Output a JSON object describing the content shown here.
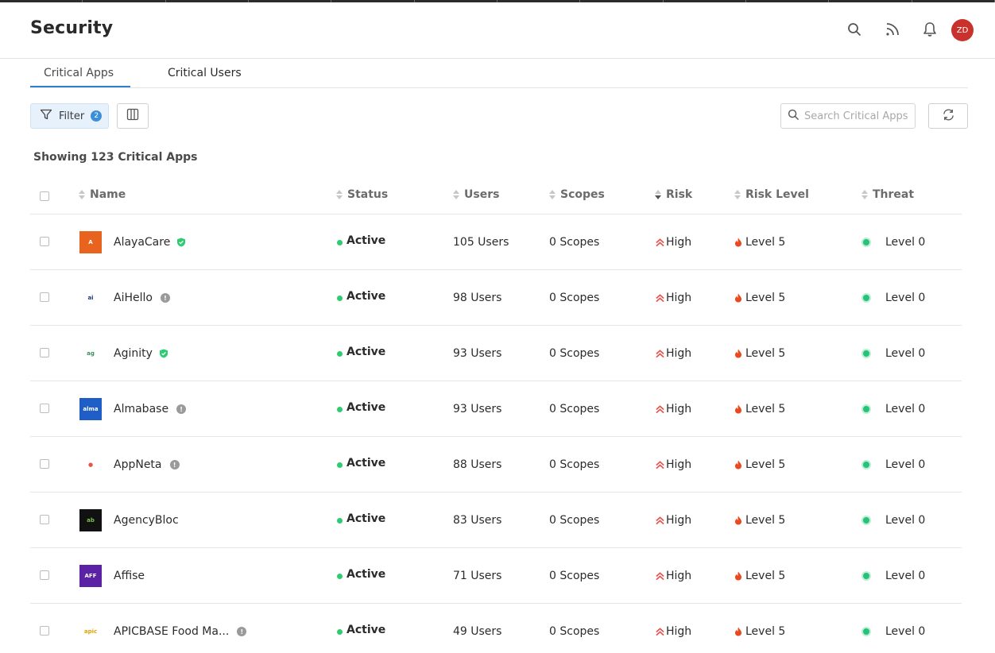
{
  "header": {
    "title": "Security",
    "avatar_initials": "ZD"
  },
  "tabs": [
    {
      "label": "Critical Apps"
    },
    {
      "label": "Critical Users"
    }
  ],
  "toolbar": {
    "filter_label": "Filter",
    "filter_count": "2",
    "search_placeholder": "Search Critical Apps"
  },
  "summary": "Showing 123 Critical Apps",
  "columns": {
    "name": "Name",
    "status": "Status",
    "users": "Users",
    "scopes": "Scopes",
    "risk": "Risk",
    "risk_level": "Risk Level",
    "threat": "Threat"
  },
  "colors": {
    "accent": "#2f7fcf",
    "status_active": "#2ecc71",
    "risk_high": "#e5534b",
    "threat": "#27c27a",
    "avatar": "#c9322c"
  },
  "rows": [
    {
      "name": "AlayaCare",
      "badge": "verified",
      "status": "Active",
      "users": "105 Users",
      "scopes": "0 Scopes",
      "risk": "High",
      "risk_level": "Level 5",
      "threat": "Level 0"
    },
    {
      "name": "AiHello",
      "badge": "info",
      "status": "Active",
      "users": "98 Users",
      "scopes": "0 Scopes",
      "risk": "High",
      "risk_level": "Level 5",
      "threat": "Level 0"
    },
    {
      "name": "Aginity",
      "badge": "verified",
      "status": "Active",
      "users": "93 Users",
      "scopes": "0 Scopes",
      "risk": "High",
      "risk_level": "Level 5",
      "threat": "Level 0"
    },
    {
      "name": "Almabase",
      "badge": "info",
      "status": "Active",
      "users": "93 Users",
      "scopes": "0 Scopes",
      "risk": "High",
      "risk_level": "Level 5",
      "threat": "Level 0"
    },
    {
      "name": "AppNeta",
      "badge": "info",
      "status": "Active",
      "users": "88 Users",
      "scopes": "0 Scopes",
      "risk": "High",
      "risk_level": "Level 5",
      "threat": "Level 0"
    },
    {
      "name": "AgencyBloc",
      "badge": "none",
      "status": "Active",
      "users": "83 Users",
      "scopes": "0 Scopes",
      "risk": "High",
      "risk_level": "Level 5",
      "threat": "Level 0"
    },
    {
      "name": "Affise",
      "badge": "none",
      "status": "Active",
      "users": "71 Users",
      "scopes": "0 Scopes",
      "risk": "High",
      "risk_level": "Level 5",
      "threat": "Level 0"
    },
    {
      "name": "APICBASE Food Ma...",
      "badge": "info",
      "status": "Active",
      "users": "49 Users",
      "scopes": "0 Scopes",
      "risk": "High",
      "risk_level": "Level 5",
      "threat": "Level 0"
    }
  ]
}
